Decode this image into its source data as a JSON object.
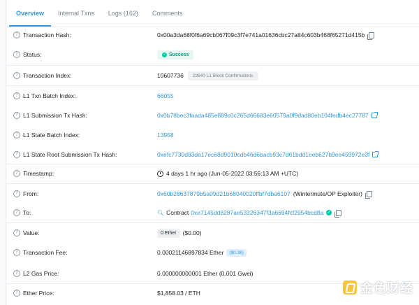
{
  "tabs": [
    {
      "label": "Overview"
    },
    {
      "label": "Internal Txns"
    },
    {
      "label": "Logs (162)"
    },
    {
      "label": "Comments"
    }
  ],
  "rows": {
    "tx_hash": {
      "label": "Transaction Hash:",
      "value": "0x00a3da68f0f6a69cb067f09c3f7e741a01636cbc27a84c603b468f65271d415b"
    },
    "status": {
      "label": "Status:",
      "value": "Success"
    },
    "tx_index": {
      "label": "Transaction Index:",
      "value": "10607736",
      "badge": "23840 L1 Block Confirmations"
    },
    "batch_index": {
      "label": "L1 Txn Batch Index:",
      "value": "66055"
    },
    "submission_hash": {
      "label": "L1 Submission Tx Hash:",
      "value": "0x0b78bec3faada485e889c0c265d66683e60579a0f9dad80eb104fedb4ec27787"
    },
    "state_batch": {
      "label": "L1 State Batch Index:",
      "value": "13958"
    },
    "state_root_hash": {
      "label": "L1 State Root Submission Tx Hash:",
      "value": "0xefc7730d83da17ec68d9010cdb46d6bacb93c7d61bdd1eeb627b9ee459972e3f"
    },
    "timestamp": {
      "label": "Timestamp:",
      "value": "4 days 1 hr ago (Jun-05-2022 03:56:13 AM +UTC)"
    },
    "from": {
      "label": "From:",
      "address": "0x60b28637879b5a09d21b68040020ffbf7dba6107",
      "tag": "(Wintermute/OP Exploiter)"
    },
    "to": {
      "label": "To:",
      "prefix": "Contract",
      "address": "0xe7145dd6287ae53326347f3a6694fcf2954bcd8a"
    },
    "value": {
      "label": "Value:",
      "amount": "0 Ether",
      "usd": "($0.00)"
    },
    "fee": {
      "label": "Transaction Fee:",
      "value": "0.00021146897834 Ether",
      "usd": "($0.38)"
    },
    "gas_price": {
      "label": "L2 Gas Price:",
      "value": "0.000000000001 Ether (0.001 Gwei)"
    },
    "ether_price": {
      "label": "Ether Price:",
      "value": "$1,858.03 / ETH"
    }
  },
  "watermark": {
    "text": "金色财经"
  },
  "icons": {
    "help": "question-circle-icon",
    "copy": "copy-icon",
    "external": "external-link-icon",
    "clock": "clock-icon",
    "contract": "contract-icon",
    "check": "check-circle-icon"
  },
  "colors": {
    "accent": "#3498db",
    "success": "#00c9a7",
    "muted": "#77838f"
  }
}
